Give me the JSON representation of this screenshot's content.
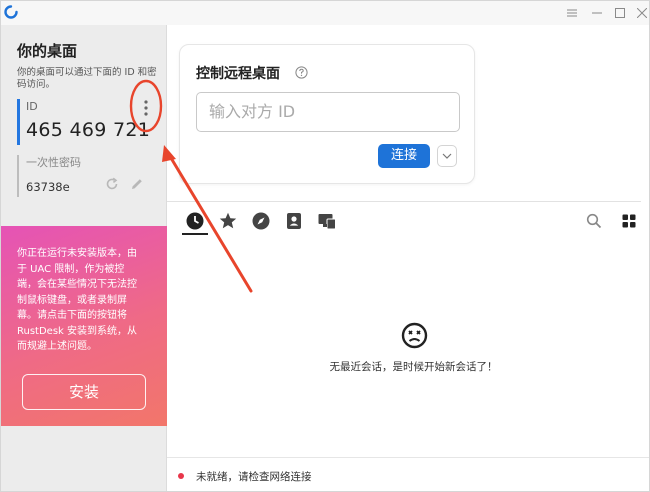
{
  "window": {
    "logo_icon": "rustdesk-logo-icon",
    "controls": [
      "menu-icon",
      "minimize-icon",
      "maximize-icon",
      "close-icon"
    ]
  },
  "left": {
    "title": "你的桌面",
    "description": "你的桌面可以通过下面的 ID 和密码访问。",
    "id_label": "ID",
    "id_value": "465 469 721",
    "password_label": "一次性密码",
    "password_value": "63738e",
    "warning_lines": [
      "你正在运行未安装版本，由",
      "于 UAC 限制，作为被控",
      "端，会在某些情况下无法控",
      "制鼠标键盘，或者录制屏",
      "幕。请点击下面的按钮将",
      "RustDesk 安装到系统，从",
      "而规避上述问题。"
    ],
    "install_label": "安装"
  },
  "control": {
    "title": "控制远程桌面",
    "input_placeholder": "输入对方 ID",
    "connect_label": "连接"
  },
  "tabs": [
    "recent-sessions-icon",
    "favorites-star-icon",
    "discovered-compass-icon",
    "address-book-icon",
    "group-devices-icon"
  ],
  "empty_state": {
    "icon": "sad-face-icon",
    "message": "无最近会话，是时候开始新会话了！"
  },
  "status": {
    "text": "未就绪，请检查网络连接",
    "dot_color": "#e8364a"
  },
  "colors": {
    "accent": "#1e73d8",
    "annotation": "#e8452c"
  }
}
